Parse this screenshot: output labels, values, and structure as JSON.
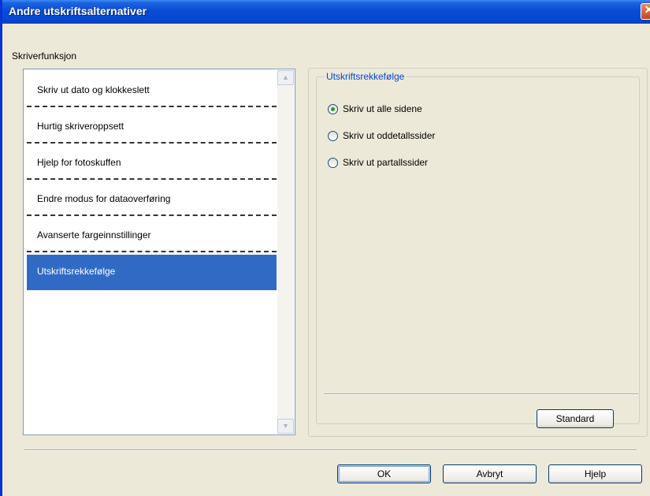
{
  "window": {
    "title": "Andre utskriftsalternativer"
  },
  "group_label": "Skriverfunksjon",
  "list": {
    "items": [
      {
        "label": "Skriv ut dato og klokkeslett",
        "selected": false
      },
      {
        "label": "Hurtig skriveroppsett",
        "selected": false
      },
      {
        "label": "Hjelp for fotoskuffen",
        "selected": false
      },
      {
        "label": "Endre modus for dataoverføring",
        "selected": false
      },
      {
        "label": "Avanserte fargeinnstillinger",
        "selected": false
      },
      {
        "label": "Utskriftsrekkefølge",
        "selected": true
      }
    ]
  },
  "print_order": {
    "legend": "Utskriftsrekkefølge",
    "options": [
      {
        "label": "Skriv ut alle sidene",
        "checked": true
      },
      {
        "label": "Skriv ut oddetallssider",
        "checked": false
      },
      {
        "label": "Skriv ut partallssider",
        "checked": false
      }
    ],
    "default_button": "Standard"
  },
  "buttons": {
    "ok": "OK",
    "cancel": "Avbryt",
    "help": "Hjelp"
  },
  "colors": {
    "title_bar": "#0a4bd3",
    "selection": "#316ac5",
    "legend_text": "#0046d5",
    "radio_dot": "#21a121"
  }
}
